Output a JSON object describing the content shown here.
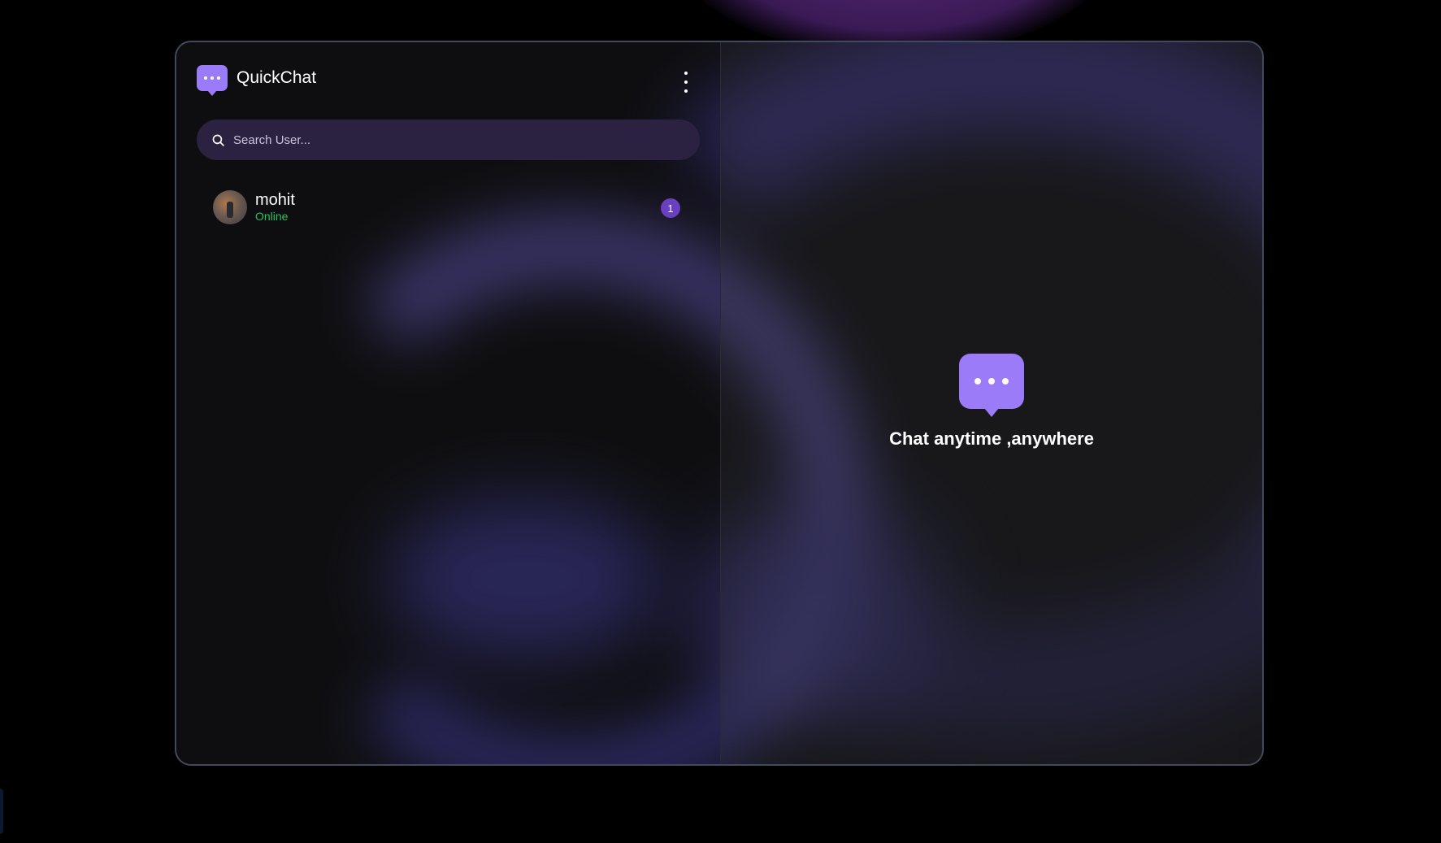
{
  "app": {
    "title": "QuickChat",
    "accent_color": "#9b7bf7"
  },
  "sidebar": {
    "search": {
      "placeholder": "Search User...",
      "value": ""
    },
    "users": [
      {
        "name": "mohit",
        "status": "Online",
        "unread_count": "1"
      }
    ]
  },
  "main": {
    "empty_state_text": "Chat anytime ,anywhere"
  },
  "icons": {
    "menu": "more-vertical-icon",
    "search": "search-icon",
    "logo": "chat-bubble-icon"
  }
}
